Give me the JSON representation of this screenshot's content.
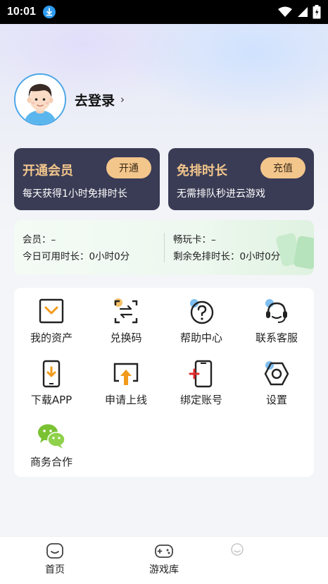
{
  "status_bar": {
    "time": "10:01",
    "icons": [
      "download-icon",
      "wifi-icon",
      "signal-icon",
      "battery-icon"
    ]
  },
  "profile": {
    "login_label": "去登录",
    "arrow": "›"
  },
  "cards": {
    "vip": {
      "title": "开通会员",
      "button": "开通",
      "subtitle": "每天获得1小时免排时长"
    },
    "queue": {
      "title": "免排时长",
      "button": "充值",
      "subtitle": "无需排队秒进云游戏"
    }
  },
  "membership": {
    "member_label": "会员：",
    "member_value": "–",
    "today_label": "今日可用时长：",
    "today_value": "0小时0分",
    "card_label": "畅玩卡：",
    "card_value": "–",
    "remaining_label": "剩余免排时长：",
    "remaining_value": "0小时0分"
  },
  "menu": [
    {
      "label": "我的资产",
      "icon": "wallet-icon"
    },
    {
      "label": "兑换码",
      "icon": "exchange-code-icon"
    },
    {
      "label": "帮助中心",
      "icon": "help-icon"
    },
    {
      "label": "联系客服",
      "icon": "headset-icon"
    },
    {
      "label": "下载APP",
      "icon": "download-app-icon"
    },
    {
      "label": "申请上线",
      "icon": "upload-icon"
    },
    {
      "label": "绑定账号",
      "icon": "bind-phone-icon"
    },
    {
      "label": "设置",
      "icon": "settings-icon"
    },
    {
      "label": "商务合作",
      "icon": "wechat-icon"
    }
  ],
  "bottom_nav": [
    {
      "label": "首页",
      "icon": "home-icon"
    },
    {
      "label": "游戏库",
      "icon": "gamepad-icon"
    },
    {
      "label": "",
      "icon": "profile-icon"
    }
  ],
  "colors": {
    "accent_gold": "#f3c68c",
    "card_bg": "#3a3c55",
    "avatar_ring": "#4aa6e8",
    "icon_blue": "#7fbff0",
    "icon_red": "#e02a2a",
    "icon_orange": "#f29b1b",
    "wechat_green": "#7ac232"
  }
}
